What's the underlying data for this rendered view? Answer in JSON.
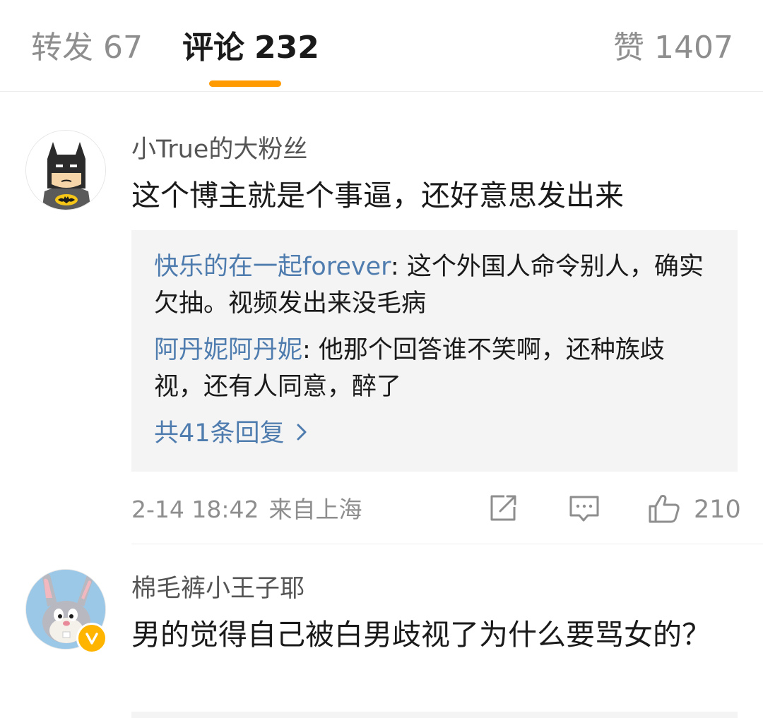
{
  "tabs": {
    "repost": {
      "label": "转发",
      "count": "67"
    },
    "comment": {
      "label": "评论",
      "count": "232"
    },
    "like": {
      "label": "赞",
      "count": "1407"
    }
  },
  "comments": [
    {
      "username": "小True的大粉丝",
      "avatar_icon": "batman-avatar",
      "text": "这个博主就是个事逼，还好意思发出来",
      "replies": [
        {
          "name": "快乐的在一起forever",
          "text": ": 这个外国人命令别人，确实欠抽。视频发出来没毛病"
        },
        {
          "name": "阿丹妮阿丹妮",
          "text": ": 他那个回答谁不笑啊，还种族歧视，还有人同意，醉了"
        }
      ],
      "more_replies": "共41条回复",
      "timestamp": "2-14 18:42",
      "source": "来自上海",
      "like_count": "210"
    },
    {
      "username": "棉毛裤小王子耶",
      "avatar_icon": "bugs-bunny-avatar",
      "verified_icon": "verified-v-icon",
      "text": "男的觉得自己被白男歧视了为什么要骂女的？"
    }
  ],
  "colors": {
    "accent": "#ff9a00",
    "link": "#4f7cae",
    "muted": "#8e8e8e",
    "verified": "#ffb400"
  }
}
